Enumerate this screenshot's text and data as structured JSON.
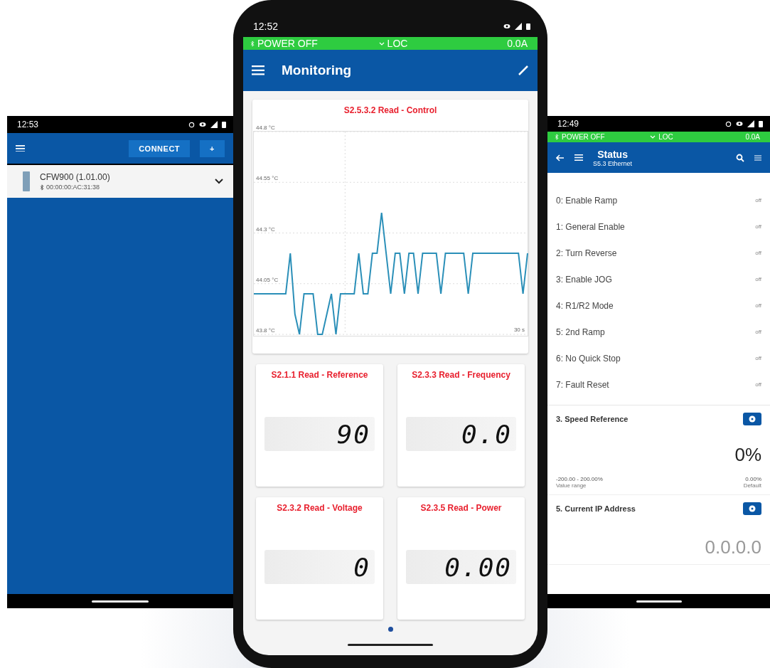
{
  "left_screen": {
    "status_bar": {
      "time": "12:53"
    },
    "toolbar": {
      "buttons": [
        "CONNECT",
        "+"
      ]
    },
    "devices": [
      {
        "name": "CFW900 (1.01.00)",
        "address": "00:00:00:AC:31:38"
      }
    ]
  },
  "center_screen": {
    "status_bar": {
      "time": "12:52"
    },
    "drive_bar": {
      "power": "POWER OFF",
      "mode": "LOC",
      "current": "0.0A"
    },
    "app_bar": {
      "title": "Monitoring"
    },
    "chart_card": {
      "title": "S2.5.3.2 Read - Control",
      "chart_data": {
        "type": "line",
        "series": [
          {
            "color": "#2a8fb8",
            "values": [
              44.0,
              44.0,
              44.0,
              44.0,
              44.0,
              44.0,
              44.0,
              44.0,
              44.2,
              43.9,
              43.8,
              44.0,
              44.0,
              44.0,
              43.8,
              43.8,
              43.9,
              44.0,
              43.8,
              44.0,
              44.0,
              44.0,
              44.0,
              44.2,
              44.0,
              44.0,
              44.2,
              44.2,
              44.4,
              44.2,
              44.0,
              44.2,
              44.2,
              44.0,
              44.2,
              44.2,
              44.0,
              44.2,
              44.2,
              44.2,
              44.2,
              44.0,
              44.2,
              44.2,
              44.2,
              44.2,
              44.2,
              44.0,
              44.2,
              44.2,
              44.2,
              44.2,
              44.2,
              44.2,
              44.2,
              44.2,
              44.2,
              44.2,
              44.2,
              44.0,
              44.2
            ]
          }
        ],
        "grid": true,
        "annotations": [
          "30 s"
        ],
        "ylim": [
          43.8,
          44.8
        ],
        "yticks": [
          {
            "value": 43.8,
            "label": "43.8 °C"
          },
          {
            "value": 44.05,
            "label": "44.05 °C"
          },
          {
            "value": 44.3,
            "label": "44.3 °C"
          },
          {
            "value": 44.55,
            "label": "44.55 °C"
          },
          {
            "value": 44.8,
            "label": "44.8 °C"
          }
        ]
      }
    },
    "gauges": [
      {
        "title": "S2.1.1 Read - Reference",
        "value": "90"
      },
      {
        "title": "S2.3.3 Read - Frequency",
        "value": "0.0"
      },
      {
        "title": "S2.3.2 Read - Voltage",
        "value": "0"
      },
      {
        "title": "S2.3.5 Read - Power",
        "value": "0.00"
      }
    ]
  },
  "right_screen": {
    "status_bar": {
      "time": "12:49"
    },
    "drive_bar": {
      "power": "POWER OFF",
      "mode": "LOC",
      "current": "0.0A"
    },
    "app_bar": {
      "title": "Status",
      "subtitle": "S5.3 Ethernet"
    },
    "bits": [
      {
        "label": "0: Enable Ramp",
        "value": "off"
      },
      {
        "label": "1: General Enable",
        "value": "off"
      },
      {
        "label": "2: Turn Reverse",
        "value": "off"
      },
      {
        "label": "3: Enable JOG",
        "value": "off"
      },
      {
        "label": "4: R1/R2 Mode",
        "value": "off"
      },
      {
        "label": "5: 2nd Ramp",
        "value": "off"
      },
      {
        "label": "6: No Quick Stop",
        "value": "off"
      },
      {
        "label": "7: Fault Reset",
        "value": "off"
      }
    ],
    "parameters": [
      {
        "kind": "numeric",
        "title": "3. Speed Reference",
        "value": "0%",
        "range": "-200.00 - 200.00%",
        "range_label": "Value range",
        "default": "0.00%",
        "default_label": "Default"
      },
      {
        "kind": "text",
        "title": "5. Current IP Address",
        "value": "0.0.0.0"
      }
    ]
  }
}
